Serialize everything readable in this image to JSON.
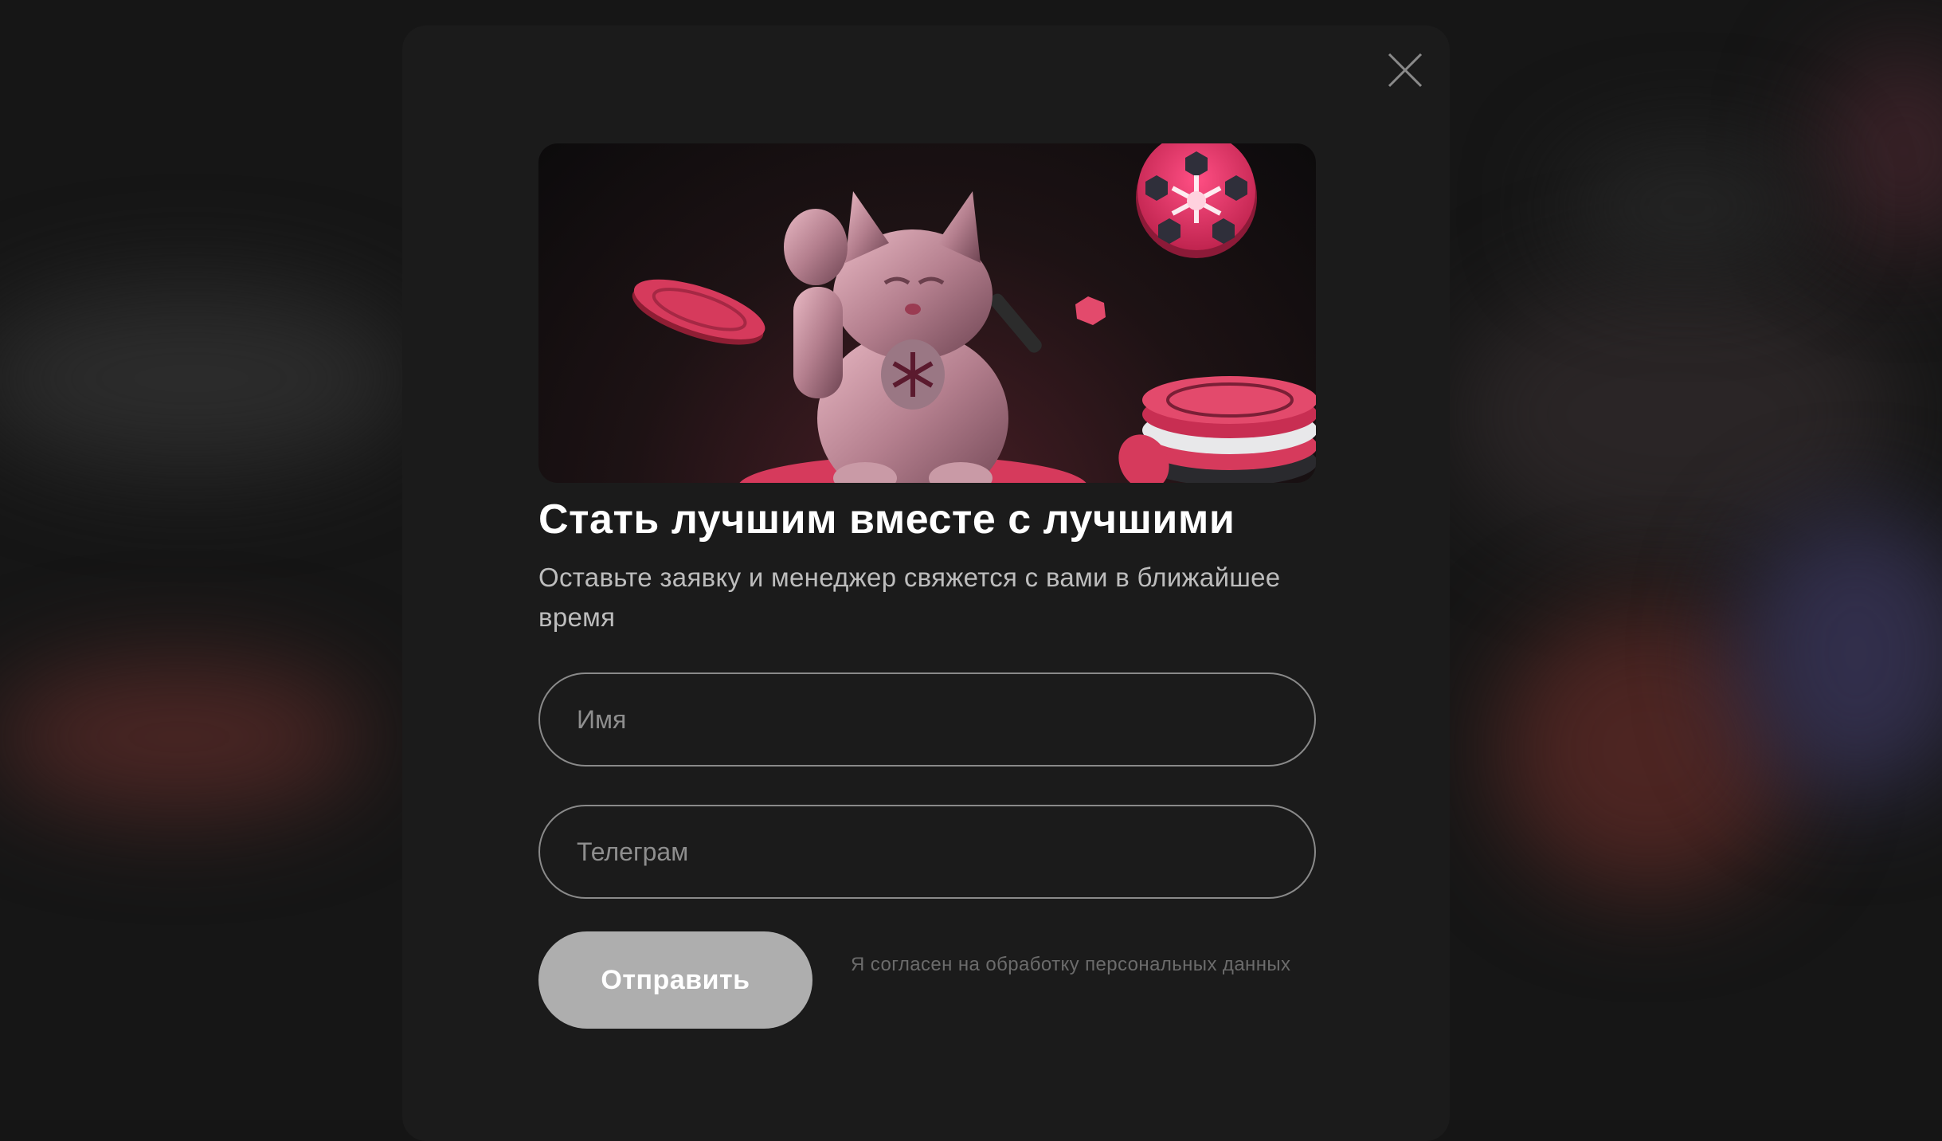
{
  "modal": {
    "title": "Стать лучшим вместе с лучшими",
    "subtitle": "Оставьте заявку и менеджер свяжется с вами в ближайшее время",
    "hero_image": "maneki-neko-with-poker-chips-illustration",
    "close_icon": "close-icon"
  },
  "form": {
    "name_placeholder": "Имя",
    "name_value": "",
    "telegram_placeholder": "Телеграм",
    "telegram_value": "",
    "submit_label": "Отправить",
    "consent_text": "Я согласен на обработку персональных данных"
  },
  "colors": {
    "page_background": "#151515",
    "modal_background": "#1b1b1b",
    "accent_pink": "#e0416a",
    "button_background": "#aeaeae"
  }
}
